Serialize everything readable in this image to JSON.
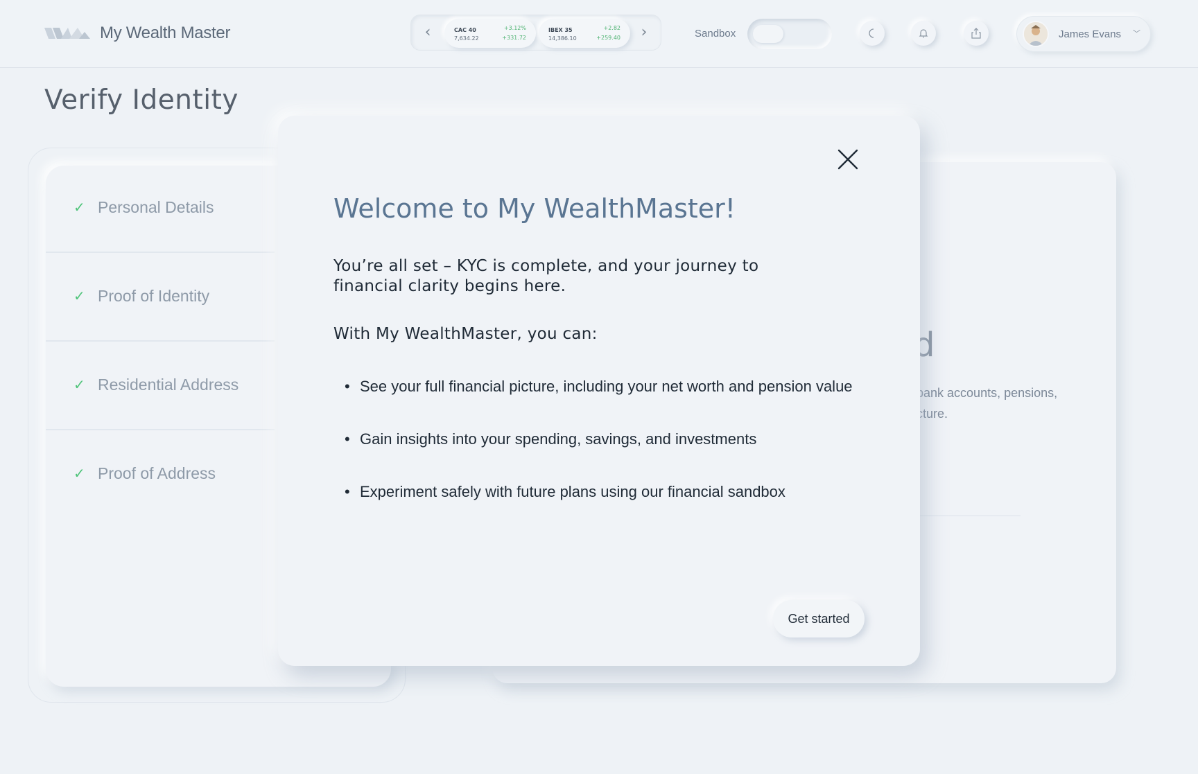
{
  "header": {
    "app_name": "My Wealth Master",
    "ticker": [
      {
        "symbol": "CAC 40",
        "price": "7,634.22",
        "pct": "+3.12%",
        "change": "+331.72"
      },
      {
        "symbol": "IBEX 35",
        "price": "14,386.10",
        "pct": "+2.82",
        "change": "+259.40"
      }
    ],
    "sandbox_label": "Sandbox",
    "sandbox_enabled": false,
    "user_name": "James Evans"
  },
  "page": {
    "title": "Verify Identity",
    "steps": [
      {
        "label": "Personal Details",
        "done": true
      },
      {
        "label": "Proof of Identity",
        "done": true
      },
      {
        "label": "Residential Address",
        "done": true
      },
      {
        "label": "Proof of Address",
        "done": true
      }
    ],
    "right_card": {
      "partial_heading": "d",
      "partial_desc_line1": "bank accounts, pensions,",
      "partial_desc_line2": "cture."
    }
  },
  "modal": {
    "title": "Welcome to My WealthMaster!",
    "intro": "You’re all set – KYC is complete, and your journey to financial clarity begins here.",
    "lead": "With My WealthMaster, you can:",
    "bullets": [
      "See your full financial picture, including your net worth and pension value",
      "Gain insights into your spending, savings, and investments",
      "Experiment safely with future plans using our financial sandbox"
    ],
    "cta_label": "Get started"
  },
  "colors": {
    "background": "#eef2f6",
    "check_green": "#4fc47a",
    "ticker_green": "#4fb372",
    "modal_title": "#5a7592"
  }
}
